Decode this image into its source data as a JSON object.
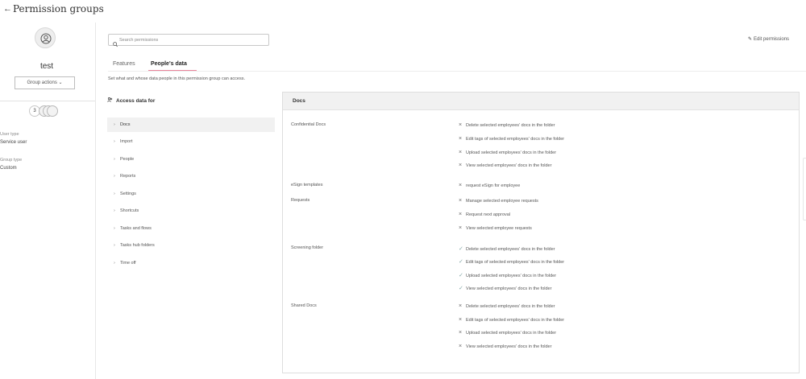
{
  "header": {
    "back_icon": "arrow-left-icon",
    "title": "Permission groups"
  },
  "sidebar": {
    "avatar_icon": "group-avatar-icon",
    "group_name": "test",
    "group_actions_label": "Group actions",
    "member_count": "3",
    "user_type_label": "User type",
    "user_type_value": "Service user",
    "group_type_label": "Group type",
    "group_type_value": "Custom"
  },
  "toolbar": {
    "search_placeholder": "Search permissions",
    "edit_label": "Edit permissions"
  },
  "tabs": [
    {
      "label": "Features",
      "active": false
    },
    {
      "label": "People's data",
      "active": true
    }
  ],
  "description": "Set what and whose data people in this permission group can access.",
  "access_title": "Access data for",
  "categories": [
    {
      "label": "Docs",
      "active": true
    },
    {
      "label": "Import",
      "active": false
    },
    {
      "label": "People",
      "active": false
    },
    {
      "label": "Reports",
      "active": false
    },
    {
      "label": "Settings",
      "active": false
    },
    {
      "label": "Shortcuts",
      "active": false
    },
    {
      "label": "Tasks and flows",
      "active": false
    },
    {
      "label": "Tasks hub folders",
      "active": false
    },
    {
      "label": "Time off",
      "active": false
    }
  ],
  "panel": {
    "title": "Docs",
    "sections": [
      {
        "name": "Confidential Docs",
        "permissions": [
          {
            "text": "Delete selected employees' docs in the folder",
            "granted": false
          },
          {
            "text": "Edit tags of selected employees' docs in the folder",
            "granted": false
          },
          {
            "text": "Upload selected employees' docs in the folder",
            "granted": false
          },
          {
            "text": "View selected employees' docs in the folder",
            "granted": false
          }
        ]
      },
      {
        "name": "eSign templates",
        "permissions": [
          {
            "text": "request eSign for employee",
            "granted": false
          }
        ]
      },
      {
        "name": "Requests",
        "permissions": [
          {
            "text": "Manage selected employee requests",
            "granted": false
          },
          {
            "text": "Request next approval",
            "granted": false
          },
          {
            "text": "View selected employee requests",
            "granted": false
          }
        ]
      },
      {
        "name": "Screening folder",
        "permissions": [
          {
            "text": "Delete selected employees' docs in the folder",
            "granted": true
          },
          {
            "text": "Edit tags of selected employees' docs in the folder",
            "granted": true
          },
          {
            "text": "Upload selected employees' docs in the folder",
            "granted": true
          },
          {
            "text": "View selected employees' docs in the folder",
            "granted": true
          }
        ]
      },
      {
        "name": "Shared Docs",
        "permissions": [
          {
            "text": "Delete selected employees' docs in the folder",
            "granted": false
          },
          {
            "text": "Edit tags of selected employees' docs in the folder",
            "granted": false
          },
          {
            "text": "Upload selected employees' docs in the folder",
            "granted": false
          },
          {
            "text": "View selected employees' docs in the folder",
            "granted": false
          }
        ]
      }
    ]
  }
}
